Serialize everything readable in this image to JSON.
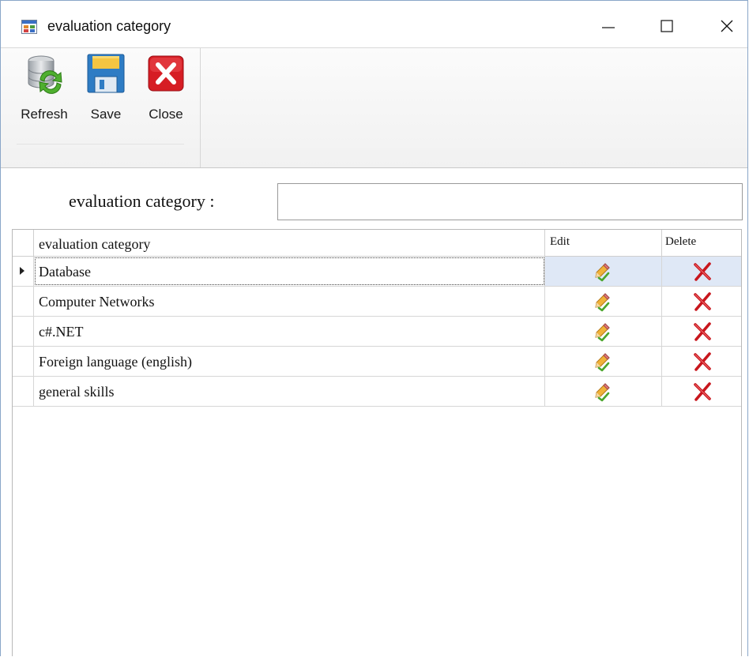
{
  "window": {
    "title": "evaluation category",
    "icon": "app-form-icon",
    "controls": [
      "minimize-icon",
      "maximize-icon",
      "close-icon"
    ]
  },
  "ribbon": {
    "buttons": [
      {
        "label": "Refresh",
        "icon": "database-refresh-icon"
      },
      {
        "label": "Save",
        "icon": "floppy-save-icon"
      },
      {
        "label": "Close",
        "icon": "red-close-icon"
      }
    ]
  },
  "form": {
    "label": "evaluation category :",
    "input_value": "",
    "input_placeholder": ""
  },
  "grid": {
    "columns": [
      "evaluation category",
      "Edit",
      "Delete"
    ],
    "rows": [
      {
        "name": "Database",
        "selected": true
      },
      {
        "name": "Computer Networks",
        "selected": false
      },
      {
        "name": "c#.NET",
        "selected": false
      },
      {
        "name": "Foreign language (english)",
        "selected": false
      },
      {
        "name": "general skills",
        "selected": false
      }
    ],
    "edit_icon": "pencil-check-icon",
    "delete_icon": "red-x-icon"
  },
  "colors": {
    "selection": "#dfe8f6",
    "window_border": "#8aa6c8",
    "delete_red": "#c8161d",
    "save_blue": "#2e7cc4"
  }
}
